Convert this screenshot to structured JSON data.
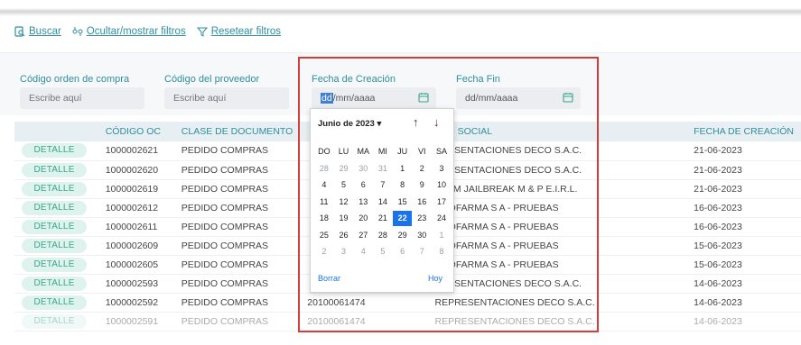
{
  "toolbar": {
    "buscar": "Buscar",
    "ocultar": "Ocultar/mostrar filtros",
    "resetear": "Resetear filtros"
  },
  "filters": {
    "codigo_oc": {
      "label": "Código orden de compra",
      "placeholder": "Escribe aquí"
    },
    "codigo_proveedor": {
      "label": "Código del proveedor",
      "placeholder": "Escribe aquí"
    },
    "fecha_creacion": {
      "label": "Fecha de Creación",
      "value_highlight": "dd",
      "value_rest": "/mm/aaaa"
    },
    "fecha_fin": {
      "label": "Fecha Fin",
      "value": "dd/mm/aaaa"
    }
  },
  "table": {
    "headers": [
      "",
      "CÓDIGO OC",
      "CLASE DE DOCUMENTO",
      "",
      "ZÓN SOCIAL",
      "",
      "FECHA DE CREACIÓN"
    ],
    "detail_label": "DETALLE",
    "rows": [
      {
        "oc": "1000002621",
        "clase": "PEDIDO COMPRAS",
        "ruc": "",
        "razon": "PRESENTACIONES DECO S.A.C.",
        "fecha": "21-06-2023"
      },
      {
        "oc": "1000002620",
        "clase": "PEDIDO COMPRAS",
        "ruc": "",
        "razon": "PRESENTACIONES DECO S.A.C.",
        "fecha": "21-06-2023"
      },
      {
        "oc": "1000002619",
        "clase": "PEDIDO COMPRAS",
        "ruc": "",
        "razon": "STEM JAILBREAK M & P E.I.R.L.",
        "fecha": "21-06-2023"
      },
      {
        "oc": "1000002612",
        "clase": "PEDIDO COMPRAS",
        "ruc": "",
        "razon": "CNOFARMA S A - PRUEBAS",
        "fecha": "16-06-2023"
      },
      {
        "oc": "1000002611",
        "clase": "PEDIDO COMPRAS",
        "ruc": "",
        "razon": "CNOFARMA S A - PRUEBAS",
        "fecha": "16-06-2023"
      },
      {
        "oc": "1000002609",
        "clase": "PEDIDO COMPRAS",
        "ruc": "",
        "razon": "CNOFARMA S A - PRUEBAS",
        "fecha": "15-06-2023"
      },
      {
        "oc": "1000002605",
        "clase": "PEDIDO COMPRAS",
        "ruc": "",
        "razon": "CNOFARMA S A - PRUEBAS",
        "fecha": "15-06-2023"
      },
      {
        "oc": "1000002593",
        "clase": "PEDIDO COMPRAS",
        "ruc": "",
        "razon": "PRESENTACIONES DECO S.A.C.",
        "fecha": "14-06-2023"
      },
      {
        "oc": "1000002592",
        "clase": "PEDIDO COMPRAS",
        "ruc": "20100061474",
        "razon": "REPRESENTACIONES DECO S.A.C.",
        "fecha": "14-06-2023"
      },
      {
        "oc": "1000002591",
        "clase": "PEDIDO COMPRAS",
        "ruc": "20100061474",
        "razon": "REPRESENTACIONES DECO S.A.C.",
        "fecha": "14-06-2023"
      }
    ]
  },
  "calendar": {
    "month_label": "Junio de 2023",
    "weekdays": [
      "DO",
      "LU",
      "MA",
      "MI",
      "JU",
      "VI",
      "SA"
    ],
    "weeks": [
      [
        {
          "d": "28",
          "o": true
        },
        {
          "d": "29",
          "o": true
        },
        {
          "d": "30",
          "o": true
        },
        {
          "d": "31",
          "o": true
        },
        {
          "d": "1"
        },
        {
          "d": "2"
        },
        {
          "d": "3"
        }
      ],
      [
        {
          "d": "4"
        },
        {
          "d": "5"
        },
        {
          "d": "6"
        },
        {
          "d": "7"
        },
        {
          "d": "8"
        },
        {
          "d": "9"
        },
        {
          "d": "10"
        }
      ],
      [
        {
          "d": "11"
        },
        {
          "d": "12"
        },
        {
          "d": "13"
        },
        {
          "d": "14"
        },
        {
          "d": "15"
        },
        {
          "d": "16"
        },
        {
          "d": "17"
        }
      ],
      [
        {
          "d": "18"
        },
        {
          "d": "19"
        },
        {
          "d": "20"
        },
        {
          "d": "21"
        },
        {
          "d": "22",
          "s": true
        },
        {
          "d": "23"
        },
        {
          "d": "24"
        }
      ],
      [
        {
          "d": "25"
        },
        {
          "d": "26"
        },
        {
          "d": "27"
        },
        {
          "d": "28"
        },
        {
          "d": "29"
        },
        {
          "d": "30"
        },
        {
          "d": "1",
          "o": true
        }
      ],
      [
        {
          "d": "2",
          "o": true
        },
        {
          "d": "3",
          "o": true
        },
        {
          "d": "4",
          "o": true
        },
        {
          "d": "5",
          "o": true
        },
        {
          "d": "6",
          "o": true
        },
        {
          "d": "7",
          "o": true
        },
        {
          "d": "8",
          "o": true
        }
      ]
    ],
    "clear_label": "Borrar",
    "today_label": "Hoy"
  }
}
